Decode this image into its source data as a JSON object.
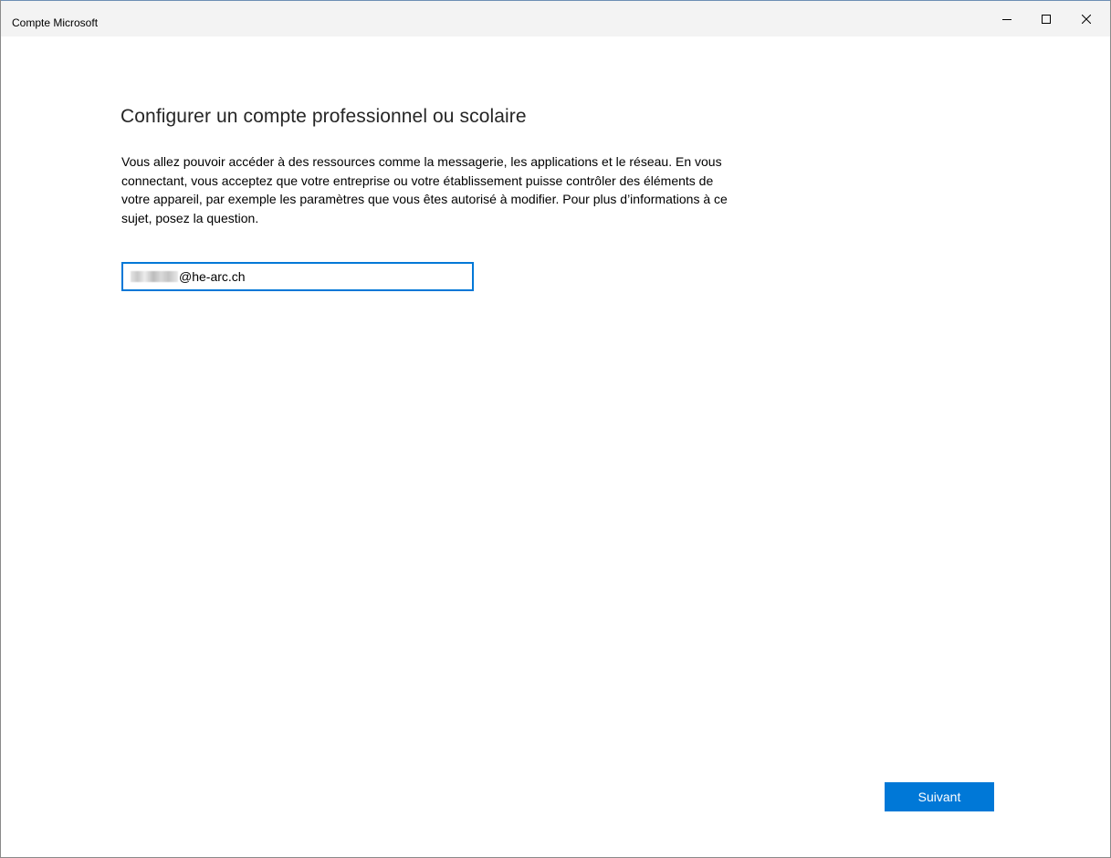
{
  "window": {
    "title": "Compte Microsoft",
    "controls": {
      "minimize_icon": "minimize-icon",
      "maximize_icon": "maximize-icon",
      "close_icon": "close-icon"
    }
  },
  "main": {
    "heading": "Configurer un compte professionnel ou scolaire",
    "description": "Vous allez pouvoir accéder à des ressources comme la messagerie, les applications et le réseau. En vous connectant, vous acceptez que votre entreprise ou votre établissement puisse contrôler des éléments de votre appareil, par exemple les paramètres que vous êtes autorisé à modifier. Pour plus d’informations à ce sujet, posez la question.",
    "email_field": {
      "visible_value": "@he-arc.ch"
    },
    "next_button_label": "Suivant"
  },
  "colors": {
    "accent": "#0078d7",
    "titlebar_bg": "#f3f3f3",
    "heading_text": "#262626"
  }
}
